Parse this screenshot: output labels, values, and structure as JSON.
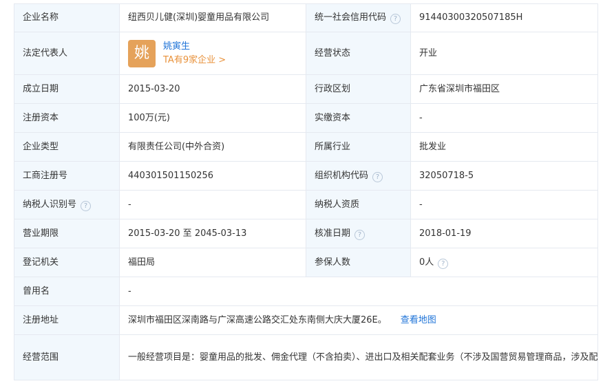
{
  "company_name": {
    "label": "企业名称",
    "value": "纽西贝儿健(深圳)婴童用品有限公司"
  },
  "credit_code": {
    "label": "统一社会信用代码",
    "value": "9144030032050718​5H"
  },
  "legal_rep": {
    "label": "法定代表人",
    "avatar_char": "姚",
    "name": "姚寅生",
    "link": "TA有9家企业 >"
  },
  "status": {
    "label": "经营状态",
    "value": "开业"
  },
  "founded": {
    "label": "成立日期",
    "value": "2015-03-20"
  },
  "region": {
    "label": "行政区划",
    "value": "广东省深圳市福田区"
  },
  "registered_capital": {
    "label": "注册资本",
    "value": "100万(元)"
  },
  "paid_capital": {
    "label": "实缴资本",
    "value": "-"
  },
  "company_type": {
    "label": "企业类型",
    "value": "有限责任公司(中外合资)"
  },
  "industry": {
    "label": "所属行业",
    "value": "批发业"
  },
  "reg_number": {
    "label": "工商注册号",
    "value": "440301501150256"
  },
  "org_code": {
    "label": "组织机构代码",
    "value": "32050718-5"
  },
  "taxpayer_id": {
    "label": "纳税人识别号",
    "value": "-"
  },
  "taxpayer_qual": {
    "label": "纳税人资质",
    "value": "-"
  },
  "business_term": {
    "label": "营业期限",
    "value": "2015-03-20 至 2045-03-13"
  },
  "approval_date": {
    "label": "核准日期",
    "value": "2018-01-19"
  },
  "authority": {
    "label": "登记机关",
    "value": "福田局"
  },
  "insured": {
    "label": "参保人数",
    "value": "0人"
  },
  "former_name": {
    "label": "曾用名",
    "value": "-"
  },
  "address": {
    "label": "注册地址",
    "value": "深圳市福田区深南路与广深高速公路交汇处东南侧大庆大厦26E。",
    "map_link": "查看地图"
  },
  "scope": {
    "label": "经营范围",
    "value": "一般经营项目是：婴童用品的批发、佣金代理（不含拍卖）、进出口及相关配套业务（不涉及国营贸易管理商品，涉及配额、许可证管理及其它专项规定管理的商品，按国家有关规定办理申请）。，许可经营项目是："
  },
  "help_glyph": "?",
  "colors": {
    "label_bg": "#f2f8fd",
    "border": "#e5e9f0",
    "link_blue": "#1e73d8",
    "link_orange": "#e8913a",
    "avatar_bg": "#e5a25a"
  }
}
